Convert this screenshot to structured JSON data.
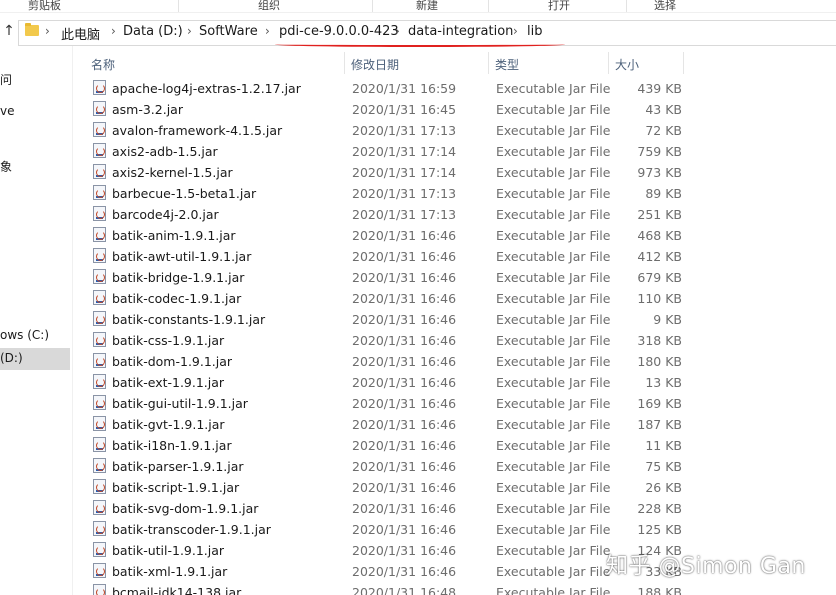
{
  "ribbon": {
    "clipboard": "剪贴板",
    "organize": "组织",
    "new": "新建",
    "open": "打开",
    "select": "选择"
  },
  "address": {
    "crumbs": [
      "此电脑",
      "Data (D:)",
      "SoftWare",
      "pdi-ce-9.0.0.0-423",
      "data-integration",
      "lib"
    ],
    "separator": "›",
    "up_arrow": "↑"
  },
  "nav": {
    "items": [
      "问",
      "ve",
      "象",
      "ows (C:)",
      "(D:)"
    ]
  },
  "columns": {
    "name": "名称",
    "date": "修改日期",
    "type": "类型",
    "size": "大小"
  },
  "files": [
    {
      "name": "apache-log4j-extras-1.2.17.jar",
      "date": "2020/1/31 16:59",
      "type": "Executable Jar File",
      "size": "439 KB"
    },
    {
      "name": "asm-3.2.jar",
      "date": "2020/1/31 16:45",
      "type": "Executable Jar File",
      "size": "43 KB"
    },
    {
      "name": "avalon-framework-4.1.5.jar",
      "date": "2020/1/31 17:13",
      "type": "Executable Jar File",
      "size": "72 KB"
    },
    {
      "name": "axis2-adb-1.5.jar",
      "date": "2020/1/31 17:14",
      "type": "Executable Jar File",
      "size": "759 KB"
    },
    {
      "name": "axis2-kernel-1.5.jar",
      "date": "2020/1/31 17:14",
      "type": "Executable Jar File",
      "size": "973 KB"
    },
    {
      "name": "barbecue-1.5-beta1.jar",
      "date": "2020/1/31 17:13",
      "type": "Executable Jar File",
      "size": "89 KB"
    },
    {
      "name": "barcode4j-2.0.jar",
      "date": "2020/1/31 17:13",
      "type": "Executable Jar File",
      "size": "251 KB"
    },
    {
      "name": "batik-anim-1.9.1.jar",
      "date": "2020/1/31 16:46",
      "type": "Executable Jar File",
      "size": "468 KB"
    },
    {
      "name": "batik-awt-util-1.9.1.jar",
      "date": "2020/1/31 16:46",
      "type": "Executable Jar File",
      "size": "412 KB"
    },
    {
      "name": "batik-bridge-1.9.1.jar",
      "date": "2020/1/31 16:46",
      "type": "Executable Jar File",
      "size": "679 KB"
    },
    {
      "name": "batik-codec-1.9.1.jar",
      "date": "2020/1/31 16:46",
      "type": "Executable Jar File",
      "size": "110 KB"
    },
    {
      "name": "batik-constants-1.9.1.jar",
      "date": "2020/1/31 16:46",
      "type": "Executable Jar File",
      "size": "9 KB"
    },
    {
      "name": "batik-css-1.9.1.jar",
      "date": "2020/1/31 16:46",
      "type": "Executable Jar File",
      "size": "318 KB"
    },
    {
      "name": "batik-dom-1.9.1.jar",
      "date": "2020/1/31 16:46",
      "type": "Executable Jar File",
      "size": "180 KB"
    },
    {
      "name": "batik-ext-1.9.1.jar",
      "date": "2020/1/31 16:46",
      "type": "Executable Jar File",
      "size": "13 KB"
    },
    {
      "name": "batik-gui-util-1.9.1.jar",
      "date": "2020/1/31 16:46",
      "type": "Executable Jar File",
      "size": "169 KB"
    },
    {
      "name": "batik-gvt-1.9.1.jar",
      "date": "2020/1/31 16:46",
      "type": "Executable Jar File",
      "size": "187 KB"
    },
    {
      "name": "batik-i18n-1.9.1.jar",
      "date": "2020/1/31 16:46",
      "type": "Executable Jar File",
      "size": "11 KB"
    },
    {
      "name": "batik-parser-1.9.1.jar",
      "date": "2020/1/31 16:46",
      "type": "Executable Jar File",
      "size": "75 KB"
    },
    {
      "name": "batik-script-1.9.1.jar",
      "date": "2020/1/31 16:46",
      "type": "Executable Jar File",
      "size": "26 KB"
    },
    {
      "name": "batik-svg-dom-1.9.1.jar",
      "date": "2020/1/31 16:46",
      "type": "Executable Jar File",
      "size": "228 KB"
    },
    {
      "name": "batik-transcoder-1.9.1.jar",
      "date": "2020/1/31 16:46",
      "type": "Executable Jar File",
      "size": "125 KB"
    },
    {
      "name": "batik-util-1.9.1.jar",
      "date": "2020/1/31 16:46",
      "type": "Executable Jar File",
      "size": "124 KB"
    },
    {
      "name": "batik-xml-1.9.1.jar",
      "date": "2020/1/31 16:46",
      "type": "Executable Jar File",
      "size": "33 KB"
    },
    {
      "name": "bcmail-jdk14-138.jar",
      "date": "2020/1/31 16:48",
      "type": "Executable Jar File",
      "size": "188 KB"
    }
  ],
  "watermark": "知乎 @Simon Gan",
  "icons": {
    "folder": "folder-icon",
    "file": "jar-file-icon",
    "up": "up-arrow-icon"
  }
}
